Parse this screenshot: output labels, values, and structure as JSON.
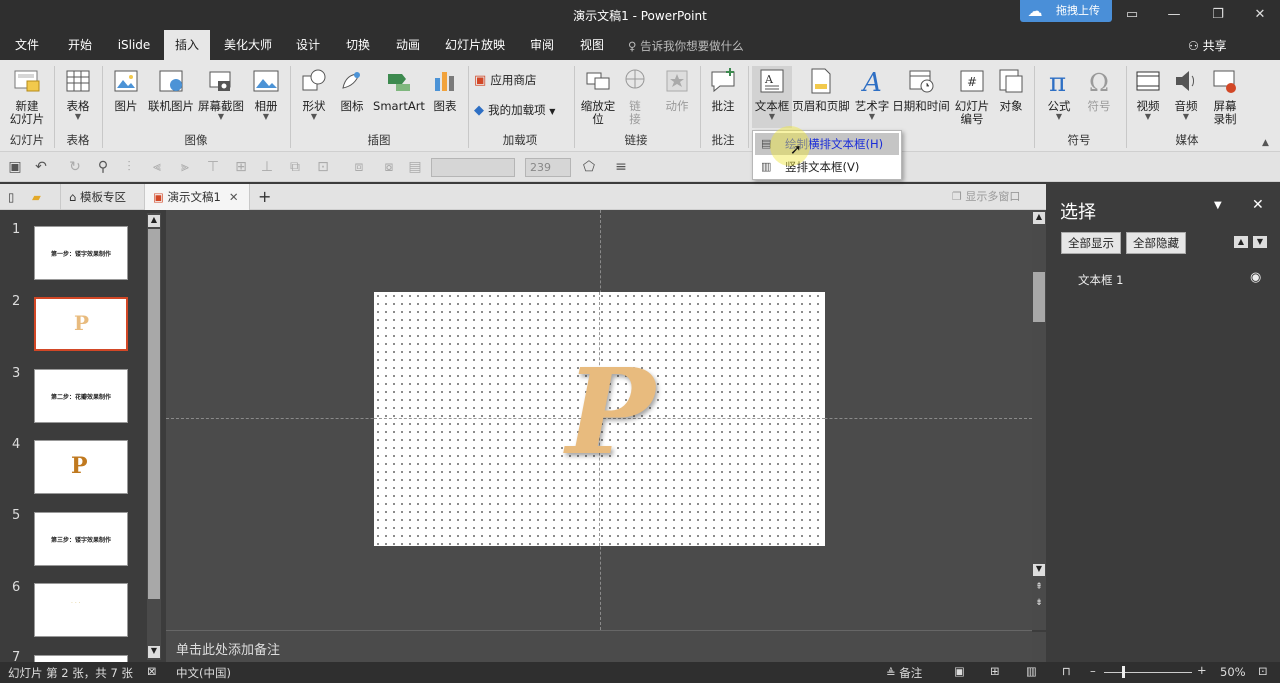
{
  "window": {
    "title": "演示文稿1  -  PowerPoint",
    "upload_label": "拖拽上传"
  },
  "tabs": [
    "文件",
    "开始",
    "iSlide",
    "插入",
    "美化大师",
    "设计",
    "切换",
    "动画",
    "幻灯片放映",
    "审阅",
    "视图"
  ],
  "active_tab": "插入",
  "tell_me": "告诉我你想要做什么",
  "share": "共享",
  "ribbon": {
    "new_slide": "新建\n幻灯片",
    "table": "表格",
    "picture": "图片",
    "online_picture": "联机图片",
    "screenshot": "屏幕截图",
    "album": "相册",
    "shapes": "形状",
    "icons": "图标",
    "smartart": "SmartArt",
    "chart": "图表",
    "store": "应用商店",
    "my_addins": "我的加载项",
    "zoom": "缩放定\n位",
    "link": "链\n接",
    "action": "动作",
    "comment": "批注",
    "textbox": "文本框",
    "header_footer": "页眉和页脚",
    "wordart": "艺术字",
    "datetime": "日期和时间",
    "slide_number": "幻灯片\n编号",
    "object": "对象",
    "equation": "公式",
    "symbol": "符号",
    "video": "视频",
    "audio": "音频",
    "screen_record": "屏幕\n录制",
    "groups": {
      "slides": "幻灯片",
      "tables": "表格",
      "images": "图像",
      "illustrations": "插图",
      "addins": "加载项",
      "links": "链接",
      "comments": "批注",
      "symbols": "符号",
      "media": "媒体"
    }
  },
  "qat": {
    "font_size": "239"
  },
  "doc_tabs": {
    "templates": "模板专区",
    "doc": "演示文稿1",
    "multi_window": "显示多窗口"
  },
  "thumbnails": [
    {
      "num": "1",
      "text": "第一步：镂字效果制作"
    },
    {
      "num": "2",
      "text": "P"
    },
    {
      "num": "3",
      "text": "第二步：花瓣效果制作"
    },
    {
      "num": "4",
      "text": "P"
    },
    {
      "num": "5",
      "text": "第三步：镂字效果制作"
    },
    {
      "num": "6",
      "text": ""
    },
    {
      "num": "7",
      "text": ""
    }
  ],
  "slide": {
    "letter": "P"
  },
  "notes_placeholder": "单击此处添加备注",
  "pane": {
    "title": "选择",
    "show_all": "全部显示",
    "hide_all": "全部隐藏",
    "items": [
      "文本框 1"
    ]
  },
  "dropdown": {
    "horizontal": "绘制横排文本框(H)",
    "vertical": "竖排文本框(V)"
  },
  "status": {
    "slide_info": "幻灯片 第 2 张，共 7 张",
    "language": "中文(中国)",
    "notes": "备注",
    "zoom": "50%"
  },
  "colors": {
    "accent": "#d24726",
    "letter": "#e8bb7e"
  }
}
